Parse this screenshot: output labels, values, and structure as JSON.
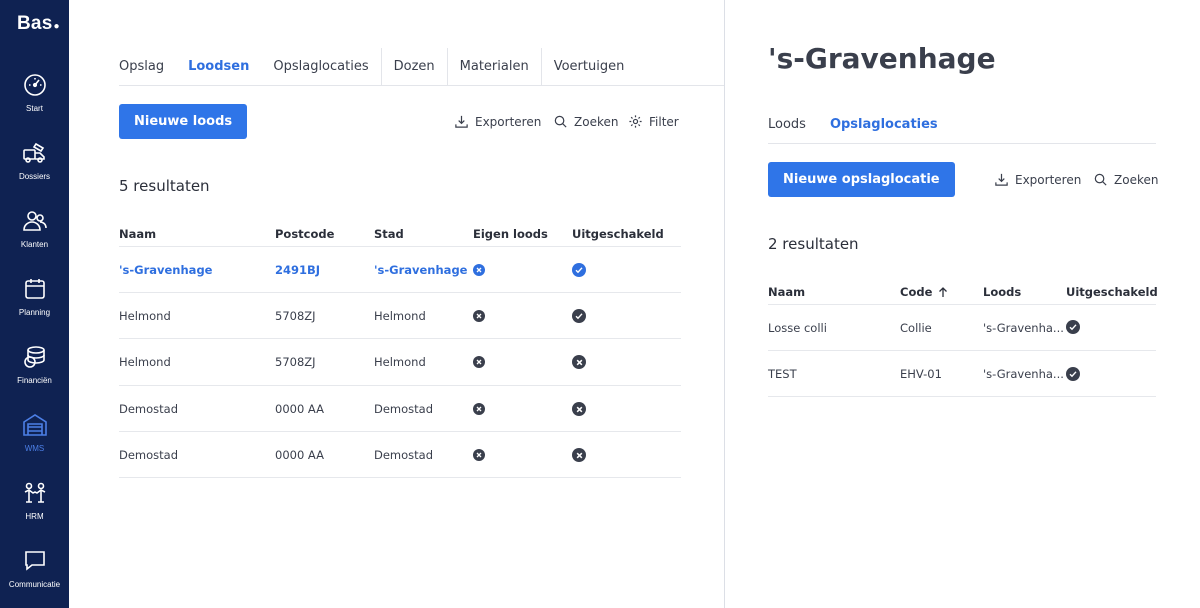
{
  "app": {
    "logo": "Bas"
  },
  "sidebar": {
    "items": [
      {
        "label": "Start",
        "icon": "dashboard-icon"
      },
      {
        "label": "Dossiers",
        "icon": "moving-truck-icon"
      },
      {
        "label": "Klanten",
        "icon": "customers-icon"
      },
      {
        "label": "Planning",
        "icon": "calendar-icon"
      },
      {
        "label": "Financiën",
        "icon": "coins-icon"
      },
      {
        "label": "WMS",
        "icon": "warehouse-icon",
        "active": true
      },
      {
        "label": "HRM",
        "icon": "people-icon"
      },
      {
        "label": "Communicatie",
        "icon": "chat-icon"
      }
    ]
  },
  "left": {
    "tabs": [
      "Opslag",
      "Loodsen",
      "Opslaglocaties",
      "Dozen",
      "Materialen",
      "Voertuigen"
    ],
    "active_tab": "Loodsen",
    "new_button": "Nieuwe loods",
    "tools": {
      "export": "Exporteren",
      "search": "Zoeken",
      "filter": "Filter"
    },
    "results": "5 resultaten",
    "columns": [
      "Naam",
      "Postcode",
      "Stad",
      "Eigen loods",
      "Uitgeschakeld"
    ],
    "rows": [
      {
        "naam": "'s-Gravenhage",
        "postcode": "2491BJ",
        "stad": "'s-Gravenhage",
        "eigen": false,
        "uit": true,
        "selected": true
      },
      {
        "naam": "Helmond",
        "postcode": "5708ZJ",
        "stad": "Helmond",
        "eigen": false,
        "uit": true
      },
      {
        "naam": "Helmond",
        "postcode": "5708ZJ",
        "stad": "Helmond",
        "eigen": false,
        "uit": false
      },
      {
        "naam": "Demostad",
        "postcode": "0000 AA",
        "stad": "Demostad",
        "eigen": false,
        "uit": false
      },
      {
        "naam": "Demostad",
        "postcode": "0000 AA",
        "stad": "Demostad",
        "eigen": false,
        "uit": false
      }
    ]
  },
  "right": {
    "title": "'s-Gravenhage",
    "tabs": [
      "Loods",
      "Opslaglocaties"
    ],
    "active_tab": "Opslaglocaties",
    "new_button": "Nieuwe opslaglocatie",
    "tools": {
      "export": "Exporteren",
      "search": "Zoeken"
    },
    "results": "2 resultaten",
    "columns": [
      "Naam",
      "Code",
      "Loods",
      "Uitgeschakeld"
    ],
    "rows": [
      {
        "naam": "Losse colli",
        "code": "Collie",
        "loods": "'s-Gravenha...",
        "uit": true
      },
      {
        "naam": "TEST",
        "code": "EHV-01",
        "loods": "'s-Gravenha...",
        "uit": true
      }
    ]
  },
  "colors": {
    "sidebar": "#0f2252",
    "accent": "#2f75e8",
    "link": "#2f6fdf",
    "icon_dark": "#3a3f4c"
  }
}
